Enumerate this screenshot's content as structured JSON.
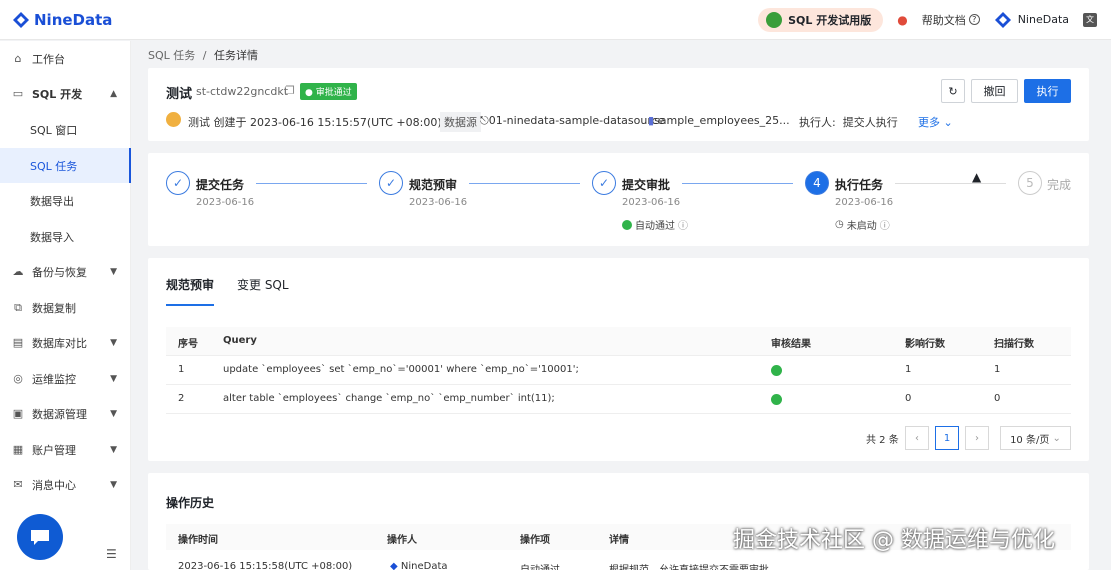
{
  "app": {
    "brand": "NineData",
    "brand_color": "#1a4fd6"
  },
  "topbar": {
    "trial_label": "SQL 开发试用版",
    "help_label": "帮助文档",
    "user_name": "NineData"
  },
  "sidebar": {
    "items": [
      {
        "label": "工作台",
        "icon": "home-icon"
      },
      {
        "label": "SQL 开发",
        "icon": "console-icon"
      },
      {
        "label": "SQL 窗口"
      },
      {
        "label": "SQL 任务"
      },
      {
        "label": "数据导出"
      },
      {
        "label": "数据导入"
      },
      {
        "label": "备份与恢复",
        "icon": "backup-icon"
      },
      {
        "label": "数据复制",
        "icon": "replicate-icon"
      },
      {
        "label": "数据库对比",
        "icon": "compare-icon"
      },
      {
        "label": "运维监控",
        "icon": "monitor-icon"
      },
      {
        "label": "数据源管理",
        "icon": "datasource-icon"
      },
      {
        "label": "账户管理",
        "icon": "account-icon"
      },
      {
        "label": "消息中心",
        "icon": "message-icon"
      }
    ]
  },
  "breadcrumb": {
    "parent": "SQL 任务",
    "separator": "/",
    "current": "任务详情"
  },
  "task": {
    "title": "测试",
    "id": "st-ctdw22gncdkt",
    "status": "审批通过",
    "creator": "测试",
    "created_text": "创建于 2023-06-16 15:15:57(UTC +08:00)",
    "datasource_label": "数据源",
    "datasource": "01-ninedata-sample-datasource",
    "database": "sample_employees_25...",
    "executor_label": "执行人:",
    "executor": "提交人执行",
    "more_label": "更多"
  },
  "buttons": {
    "undo": "撤回",
    "execute": "执行"
  },
  "steps": [
    {
      "num": "✓",
      "label": "提交任务",
      "date": "2023-06-16"
    },
    {
      "num": "✓",
      "label": "规范预审",
      "date": "2023-06-16"
    },
    {
      "num": "✓",
      "label": "提交审批",
      "date": "2023-06-16",
      "note": "自动通过"
    },
    {
      "num": "4",
      "label": "执行任务",
      "date": "2023-06-16",
      "note": "未启动"
    },
    {
      "num": "5",
      "label": "完成"
    }
  ],
  "tabs": [
    "规范预审",
    "变更 SQL"
  ],
  "table": {
    "headers": [
      "序号",
      "Query",
      "审核结果",
      "影响行数",
      "扫描行数"
    ],
    "rows": [
      {
        "no": "1",
        "query": "update `employees` set `emp_no`='00001' where `emp_no`='10001';",
        "affected": "1",
        "scanned": "1"
      },
      {
        "no": "2",
        "query": "alter table `employees` change `emp_no` `emp_number` int(11);",
        "affected": "0",
        "scanned": "0"
      }
    ]
  },
  "pagination": {
    "total": "共 2 条",
    "page": "1",
    "page_size": "10 条/页"
  },
  "history": {
    "title": "操作历史",
    "headers": [
      "操作时间",
      "操作人",
      "操作项",
      "详情"
    ],
    "row": {
      "time": "2023-06-16 15:15:58(UTC +08:00)",
      "operator": "NineData",
      "action": "自动通过",
      "detail": "根据规范，允许直接提交不需要审批"
    }
  },
  "watermark": "掘金技术社区 @ 数据运维与优化"
}
